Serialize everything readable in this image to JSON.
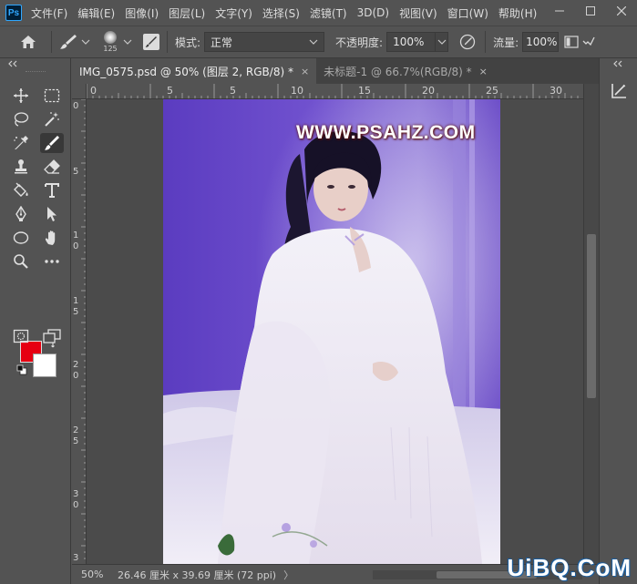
{
  "app": {
    "logo": "Ps",
    "menu": [
      "文件(F)",
      "编辑(E)",
      "图像(I)",
      "图层(L)",
      "文字(Y)",
      "选择(S)",
      "滤镜(T)",
      "3D(D)",
      "视图(V)",
      "窗口(W)",
      "帮助(H)"
    ]
  },
  "options": {
    "brush_size": "125",
    "mode_label": "模式:",
    "mode_value": "正常",
    "opacity_label": "不透明度:",
    "opacity_value": "100%",
    "flow_label": "流量:",
    "flow_value": "100%"
  },
  "tabs": [
    {
      "label": "IMG_0575.psd @ 50% (图层 2, RGB/8) *",
      "close": "×",
      "active": true
    },
    {
      "label": "未标题-1 @ 66.7%(RGB/8) *",
      "close": "×",
      "active": false
    }
  ],
  "ruler": {
    "h_labels": [
      "0",
      "5",
      "0",
      "5",
      "10",
      "15",
      "20",
      "25",
      "30"
    ],
    "v_labels": [
      "0",
      "5",
      "1",
      "0",
      "1",
      "5",
      "2",
      "0",
      "2",
      "5",
      "3",
      "0",
      "3"
    ]
  },
  "canvas": {
    "watermark": "WWW.PSAHZ.COM"
  },
  "status": {
    "zoom": "50%",
    "doc_info": "26.46 厘米 x 39.69 厘米 (72 ppi)",
    "arrow": "〉"
  },
  "site_logo": "UiBQ.CoM",
  "colors": {
    "foreground": "#e60012",
    "background": "#ffffff",
    "accent": "#31a8ff"
  }
}
